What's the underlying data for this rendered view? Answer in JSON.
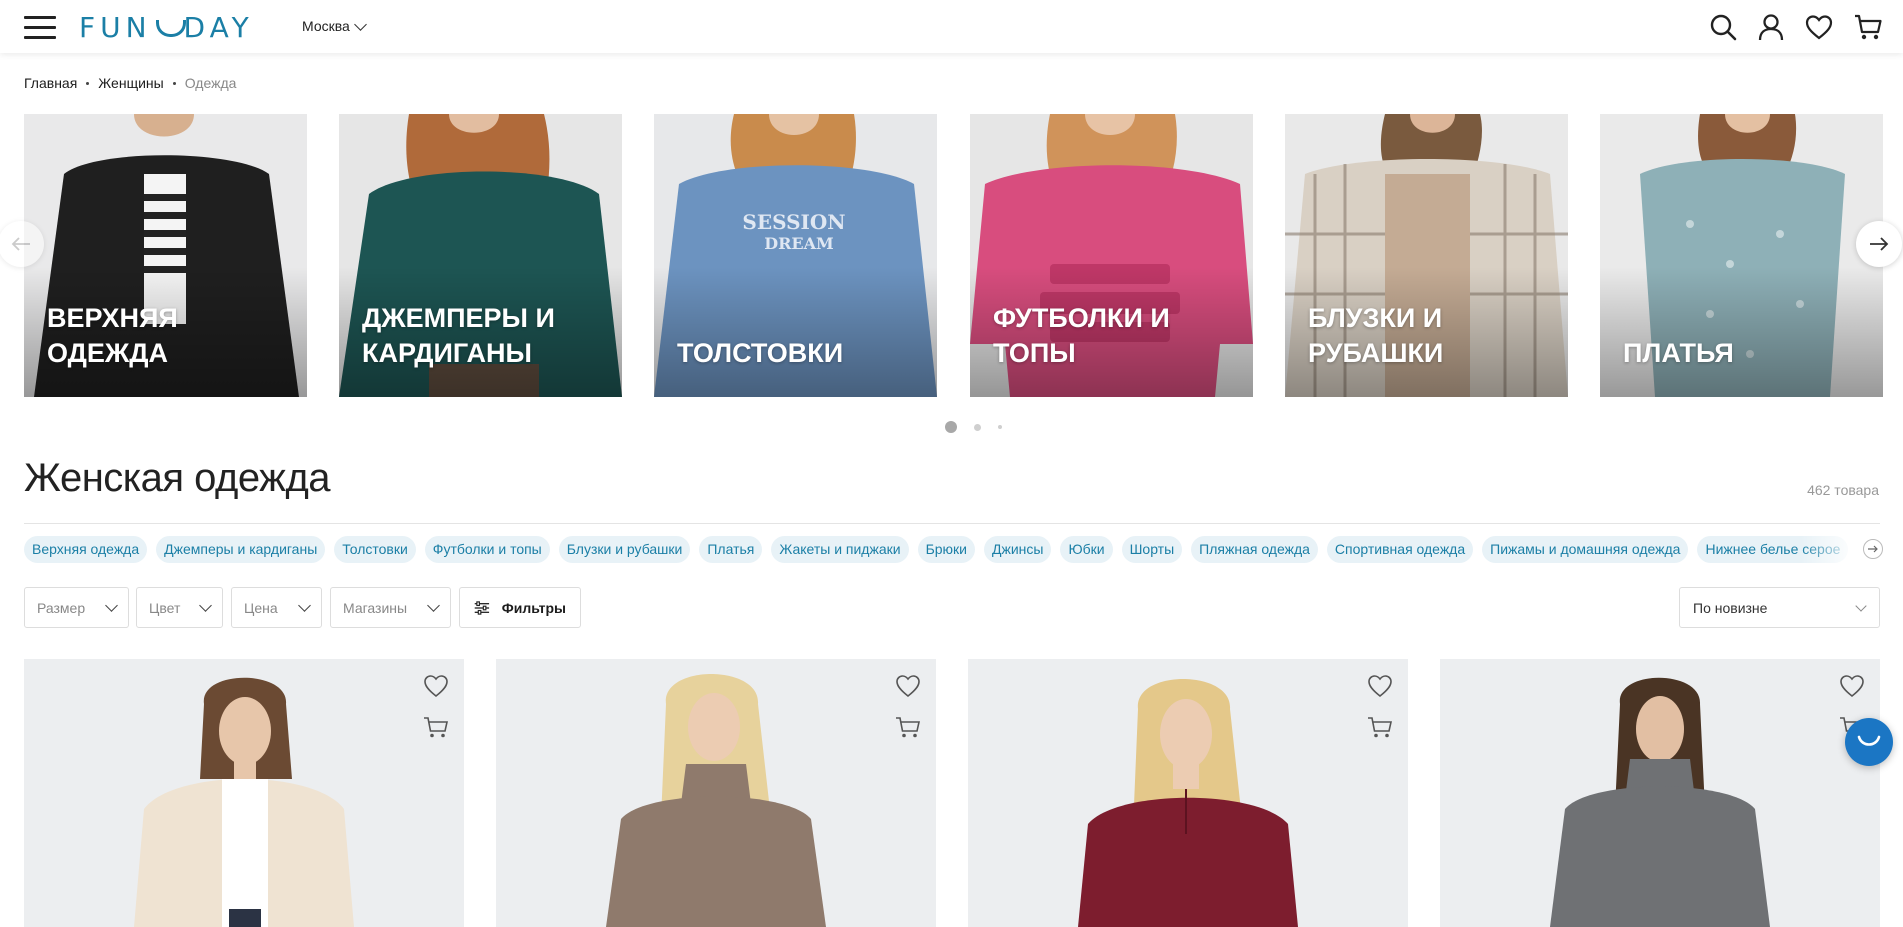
{
  "header": {
    "logo": "FUN DAY",
    "logo_left": "FUN",
    "logo_right": "DAY",
    "city": "Москва",
    "icons": [
      "search-icon",
      "user-icon",
      "heart-icon",
      "cart-icon"
    ]
  },
  "breadcrumbs": [
    "Главная",
    "Женщины",
    "Одежда"
  ],
  "categories": [
    {
      "label": "Верхняя одежда",
      "color": "#2b2b2b"
    },
    {
      "label": "Джемперы и кардиганы",
      "color": "#1d5553"
    },
    {
      "label": "Толстовки",
      "color": "#6c93c0"
    },
    {
      "label": "Футболки и топы",
      "color": "#d84d7e"
    },
    {
      "label": "Блузки и рубашки",
      "color": "#c9bfb2"
    },
    {
      "label": "Платья",
      "color": "#8eb0b7"
    }
  ],
  "carousel_dots": 3,
  "page_title": "Женская одежда",
  "count": "462 товара",
  "chips": [
    "Верхняя одежда",
    "Джемперы и кардиганы",
    "Толстовки",
    "Футболки и топы",
    "Блузки и рубашки",
    "Платья",
    "Жакеты и пиджаки",
    "Брюки",
    "Джинсы",
    "Юбки",
    "Шорты",
    "Пляжная одежда",
    "Спортивная одежда",
    "Пижамы и домашняя одежда",
    "Нижнее белье серое"
  ],
  "filters": {
    "size": "Размер",
    "color": "Цвет",
    "price": "Цена",
    "stores": "Магазины",
    "filters_button": "Фильтры",
    "sort": "По новизне"
  },
  "products": [
    {
      "color": "#efe3d2",
      "hair": "#6b4a33"
    },
    {
      "color": "#8f7a6c",
      "hair": "#e7d29c"
    },
    {
      "color": "#7d1d2e",
      "hair": "#e4c88a"
    },
    {
      "color": "#6f7174",
      "hair": "#4a3424"
    }
  ],
  "colors": {
    "brand": "#1b7fa6",
    "chip_bg": "#e8f2f7",
    "chat": "#1b76c4"
  }
}
